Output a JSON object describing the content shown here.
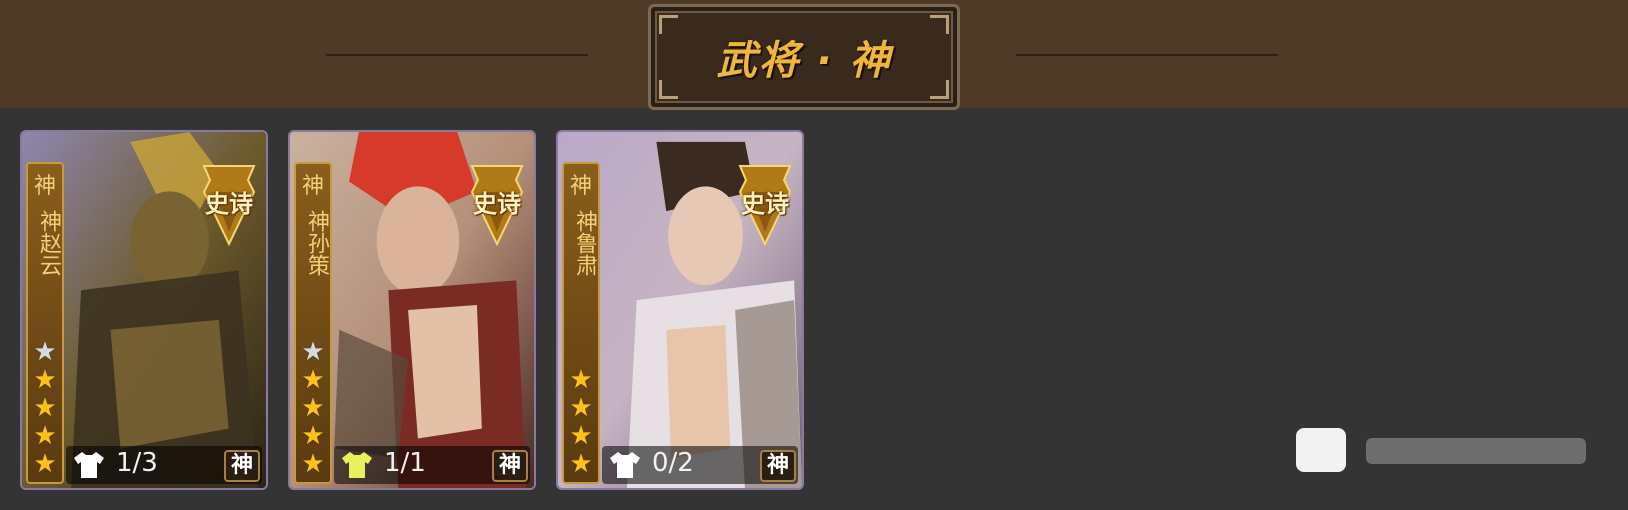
{
  "header": {
    "title": "武将 · 神"
  },
  "cards": [
    {
      "faction": "神",
      "name": "神赵云",
      "rarity_badge": "史诗",
      "stars": {
        "silver": 1,
        "gold": 4
      },
      "skin_count": "1/3",
      "type_badge": "神",
      "shirt_icon_color": "#ffffff",
      "art_colors": [
        "#6d5a2c",
        "#2b2416",
        "#a88844"
      ]
    },
    {
      "faction": "神",
      "name": "神孙策",
      "rarity_badge": "史诗",
      "stars": {
        "silver": 1,
        "gold": 4
      },
      "skin_count": "1/1",
      "type_badge": "神",
      "shirt_icon_color": "#e8f25a",
      "art_colors": [
        "#b5907a",
        "#7a2b24",
        "#d9b39a"
      ]
    },
    {
      "faction": "神",
      "name": "神鲁肃",
      "rarity_badge": "史诗",
      "stars": {
        "silver": 0,
        "gold": 4
      },
      "skin_count": "0/2",
      "type_badge": "神",
      "shirt_icon_color": "#ffffff",
      "art_colors": [
        "#c7b4c2",
        "#e6d4d1",
        "#7d6a60"
      ]
    }
  ],
  "colors": {
    "header_bg": "#4f3a28",
    "page_bg": "#343434",
    "title_gold": "#f0b53b",
    "star_gold": "#ffc21a"
  }
}
